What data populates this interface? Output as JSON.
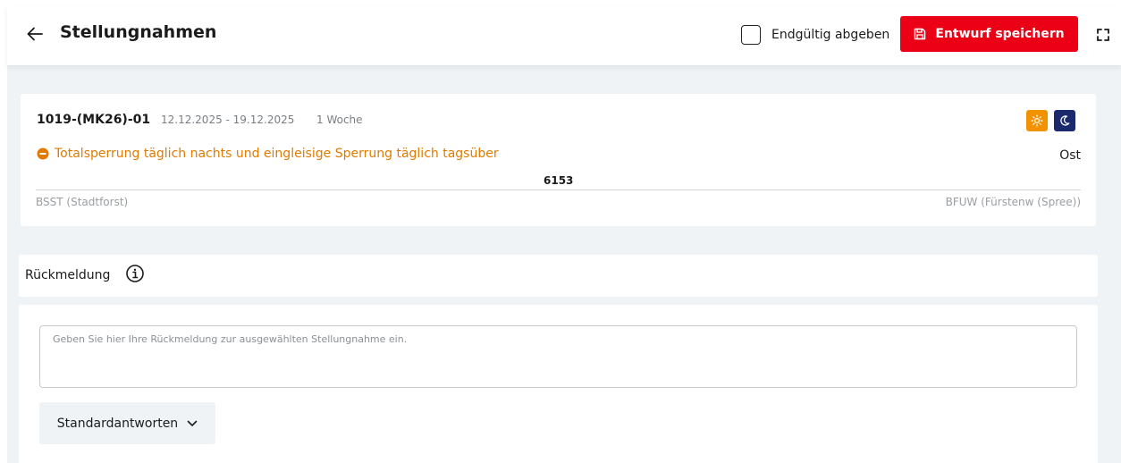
{
  "header": {
    "title": "Stellungnahmen",
    "final_submit_label": "Endgültig abgeben",
    "final_submit_checked": false,
    "save_label": "Entwurf speichern"
  },
  "measure": {
    "id": "1019-(MK26)-01",
    "date_range": "12.12.2025 - 19.12.2025",
    "duration": "1 Woche",
    "closure_text": "Totalsperrung täglich nachts und eingleisige Sperrung täglich tagsüber",
    "direction": "Ost",
    "line_number": "6153",
    "from_station": "BSST (Stadtforst)",
    "to_station": "BFUW (Fürstenw (Spree))"
  },
  "feedback": {
    "title": "Rückmeldung",
    "placeholder": "Geben Sie hier Ihre Rückmeldung zur ausgewählten Stellungnahme ein.",
    "standard_answers_label": "Standardantworten"
  },
  "colors": {
    "primary_red": "#ec0016",
    "warning_orange": "#e07b00",
    "sun_badge": "#f39200",
    "moon_badge": "#1a2a6c",
    "background": "#f0f3f5"
  },
  "icons": {
    "back": "arrow-left-icon",
    "save": "floppy-disk-icon",
    "expand": "fullscreen-icon",
    "day": "sun-icon",
    "night": "moon-icon",
    "closure": "minus-circle-icon",
    "info": "info-icon",
    "dropdown": "chevron-down-icon"
  }
}
